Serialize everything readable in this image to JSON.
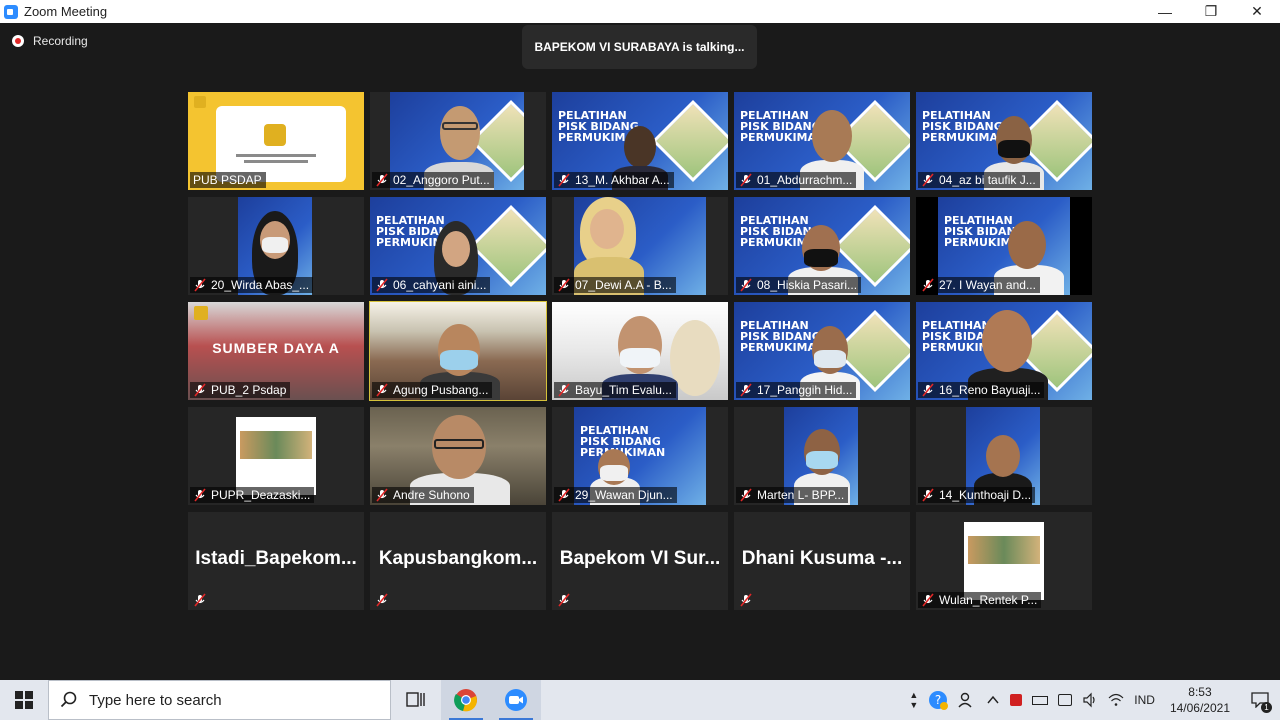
{
  "window": {
    "title": "Zoom Meeting",
    "controls": {
      "minimize": "—",
      "maximize": "❐",
      "close": "✕"
    }
  },
  "recording": {
    "label": "Recording"
  },
  "talking": {
    "text": "BAPEKOM VI SURABAYA is talking..."
  },
  "tiles": [
    {
      "name": "PUB PSDAP",
      "muted": false
    },
    {
      "name": "02_Anggoro Put...",
      "muted": true
    },
    {
      "name": "13_M. Akhbar A...",
      "muted": true
    },
    {
      "name": "01_Abdurrachm...",
      "muted": true
    },
    {
      "name": "04_az bi taufik J...",
      "muted": true
    },
    {
      "name": "20_Wirda Abas_...",
      "muted": true
    },
    {
      "name": "06_cahyani aini...",
      "muted": true
    },
    {
      "name": "07_Dewi A.A - B...",
      "muted": true
    },
    {
      "name": "08_Hiskia Pasari...",
      "muted": true
    },
    {
      "name": "27. I Wayan and...",
      "muted": true
    },
    {
      "name": "PUB_2 Psdap",
      "muted": true
    },
    {
      "name": "Agung Pusbang...",
      "muted": true
    },
    {
      "name": "Bayu_Tim Evalu...",
      "muted": true
    },
    {
      "name": "17_Panggih Hid...",
      "muted": true
    },
    {
      "name": "16_Reno Bayuaji...",
      "muted": true
    },
    {
      "name": "PUPR_Deazaski...",
      "muted": true
    },
    {
      "name": "Andre Suhono",
      "muted": true
    },
    {
      "name": "29_Wawan Djun...",
      "muted": true
    },
    {
      "name": "Marten L- BPP...",
      "muted": true
    },
    {
      "name": "14_Kunthoaji D...",
      "muted": true
    },
    {
      "name": "",
      "big": "Istadi_Bapekom...",
      "muted": true
    },
    {
      "name": "",
      "big": "Kapusbangkom...",
      "muted": true
    },
    {
      "name": "",
      "big": "Bapekom VI Sur...",
      "muted": true
    },
    {
      "name": "",
      "big": "Dhani Kusuma -...",
      "muted": true
    },
    {
      "name": "Wulan_Rentek P...",
      "muted": true
    }
  ],
  "banner": {
    "line1": "PELATIHAN",
    "line2": "PISK BIDANG",
    "line3": "PERMUKIMAN",
    "scene": "SUMBER DAYA A"
  },
  "taskbar": {
    "search_placeholder": "Type here to search",
    "language": "IND",
    "time": "8:53",
    "date": "14/06/2021",
    "notification_count": "1"
  },
  "icons": [
    "zoom-app-icon",
    "windows-start-icon",
    "search-icon",
    "task-view-icon",
    "chrome-icon",
    "zoom-taskbar-icon",
    "help-icon",
    "people-icon",
    "chevron-up-icon",
    "volume-icon",
    "network-icon",
    "notification-icon",
    "muted-mic-icon"
  ]
}
